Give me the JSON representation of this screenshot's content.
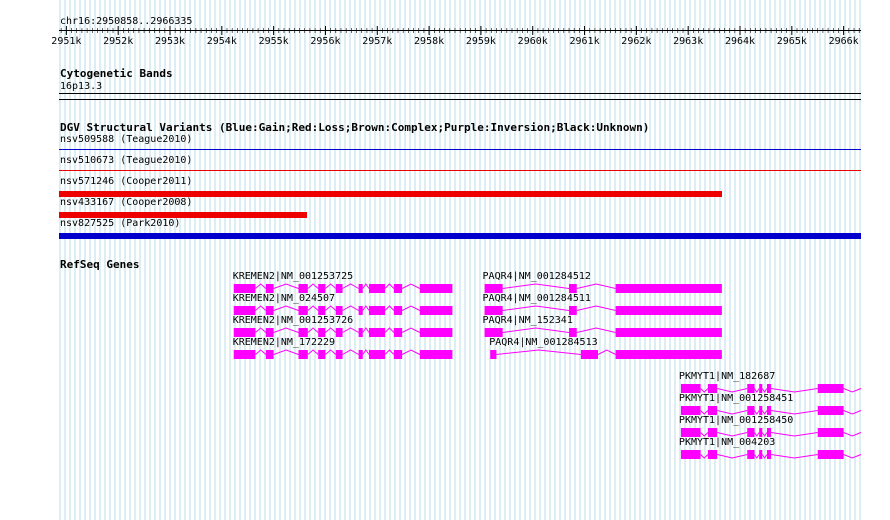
{
  "browser": {
    "region": "chr16:2950858..2966335",
    "region_start": 2950858,
    "region_end": 2966335,
    "ruler_ticks": [
      "2951k",
      "2952k",
      "2953k",
      "2954k",
      "2955k",
      "2956k",
      "2957k",
      "2958k",
      "2959k",
      "2960k",
      "2961k",
      "2962k",
      "2963k",
      "2964k",
      "2965k",
      "2966k"
    ],
    "ruler_tick_values": [
      2951000,
      2952000,
      2953000,
      2954000,
      2955000,
      2956000,
      2957000,
      2958000,
      2959000,
      2960000,
      2961000,
      2962000,
      2963000,
      2964000,
      2965000,
      2966000
    ],
    "colors": {
      "grid": "#b8dce8",
      "gain": "#0000cc",
      "loss": "#ee0000",
      "gene": "#ff00ff"
    }
  },
  "cytoband_track": {
    "title": "Cytogenetic Bands",
    "band": "16p13.3"
  },
  "dgv_track": {
    "title": "DGV Structural Variants (Blue:Gain;Red:Loss;Brown:Complex;Purple:Inversion;Black:Unknown)",
    "variants": [
      {
        "label": "nsv509588 (Teague2010)",
        "type": "gain",
        "style": "thin",
        "start": 2950858,
        "end": 2966335
      },
      {
        "label": "nsv510673 (Teague2010)",
        "type": "loss",
        "style": "thin",
        "start": 2950858,
        "end": 2966335
      },
      {
        "label": "nsv571246 (Cooper2011)",
        "type": "loss",
        "style": "thick",
        "start": 2950858,
        "end": 2963650
      },
      {
        "label": "nsv433167 (Cooper2008)",
        "type": "loss",
        "style": "thick",
        "start": 2950858,
        "end": 2955650
      },
      {
        "label": "nsv827525 (Park2010)",
        "type": "gain",
        "style": "thick",
        "start": 2950858,
        "end": 2966335
      }
    ]
  },
  "refseq_track": {
    "title": "RefSeq Genes",
    "genes": [
      {
        "label": "KREMEN2|NM_001253725",
        "strand": "+",
        "start": 2954230,
        "end": 2958450,
        "exons": [
          [
            2954230,
            2954650
          ],
          [
            2954850,
            2955000
          ],
          [
            2955480,
            2955660
          ],
          [
            2955860,
            2956000
          ],
          [
            2956200,
            2956330
          ],
          [
            2956640,
            2956720
          ],
          [
            2956840,
            2957150
          ],
          [
            2957320,
            2957480
          ],
          [
            2957820,
            2958450
          ]
        ]
      },
      {
        "label": "KREMEN2|NM_024507",
        "strand": "+",
        "start": 2954230,
        "end": 2958450,
        "exons": [
          [
            2954230,
            2954650
          ],
          [
            2954850,
            2955000
          ],
          [
            2955480,
            2955660
          ],
          [
            2955860,
            2956000
          ],
          [
            2956200,
            2956330
          ],
          [
            2956640,
            2956720
          ],
          [
            2956840,
            2957150
          ],
          [
            2957320,
            2957480
          ],
          [
            2957820,
            2958450
          ]
        ]
      },
      {
        "label": "KREMEN2|NM_001253726",
        "strand": "+",
        "start": 2954230,
        "end": 2958450,
        "exons": [
          [
            2954230,
            2954650
          ],
          [
            2954850,
            2955000
          ],
          [
            2955480,
            2955660
          ],
          [
            2955860,
            2956000
          ],
          [
            2956200,
            2956330
          ],
          [
            2956640,
            2956720
          ],
          [
            2956840,
            2957150
          ],
          [
            2957320,
            2957480
          ],
          [
            2957820,
            2958450
          ]
        ]
      },
      {
        "label": "KREMEN2|NM_172229",
        "strand": "+",
        "start": 2954230,
        "end": 2958450,
        "exons": [
          [
            2954230,
            2954650
          ],
          [
            2954850,
            2955000
          ],
          [
            2955480,
            2955660
          ],
          [
            2955860,
            2956000
          ],
          [
            2956200,
            2956330
          ],
          [
            2956640,
            2956720
          ],
          [
            2956840,
            2957150
          ],
          [
            2957320,
            2957480
          ],
          [
            2957820,
            2958450
          ]
        ]
      },
      {
        "label": "PAQR4|NM_001284512",
        "strand": "+",
        "start": 2959070,
        "end": 2963650,
        "exons": [
          [
            2959070,
            2959420
          ],
          [
            2960700,
            2960850
          ],
          [
            2961600,
            2963650
          ]
        ]
      },
      {
        "label": "PAQR4|NM_001284511",
        "strand": "+",
        "start": 2959070,
        "end": 2963650,
        "exons": [
          [
            2959070,
            2959420
          ],
          [
            2960700,
            2960850
          ],
          [
            2961600,
            2963650
          ]
        ]
      },
      {
        "label": "PAQR4|NM_152341",
        "strand": "+",
        "start": 2959070,
        "end": 2963650,
        "exons": [
          [
            2959070,
            2959420
          ],
          [
            2960700,
            2960850
          ],
          [
            2961600,
            2963650
          ]
        ]
      },
      {
        "label": "PAQR4|NM_001284513",
        "strand": "+",
        "start": 2959180,
        "end": 2963650,
        "exons": [
          [
            2959180,
            2959300
          ],
          [
            2960930,
            2961260
          ],
          [
            2961600,
            2963650
          ]
        ]
      },
      {
        "label": "PKMYT1|NM_182687",
        "strand": "-",
        "start": 2962860,
        "end": 2966335,
        "exons": [
          [
            2962860,
            2963240
          ],
          [
            2963380,
            2963560
          ],
          [
            2964140,
            2964280
          ],
          [
            2964370,
            2964430
          ],
          [
            2964520,
            2964600
          ],
          [
            2965500,
            2966000
          ]
        ]
      },
      {
        "label": "PKMYT1|NM_001258451",
        "strand": "-",
        "start": 2962860,
        "end": 2966335,
        "exons": [
          [
            2962860,
            2963240
          ],
          [
            2963380,
            2963560
          ],
          [
            2964140,
            2964280
          ],
          [
            2964370,
            2964430
          ],
          [
            2964520,
            2964600
          ],
          [
            2965500,
            2966000
          ]
        ]
      },
      {
        "label": "PKMYT1|NM_001258450",
        "strand": "-",
        "start": 2962860,
        "end": 2966335,
        "exons": [
          [
            2962860,
            2963240
          ],
          [
            2963380,
            2963560
          ],
          [
            2964140,
            2964280
          ],
          [
            2964370,
            2964430
          ],
          [
            2964520,
            2964600
          ],
          [
            2965500,
            2966000
          ]
        ]
      },
      {
        "label": "PKMYT1|NM_004203",
        "strand": "-",
        "start": 2962860,
        "end": 2966335,
        "exons": [
          [
            2962860,
            2963240
          ],
          [
            2963380,
            2963560
          ],
          [
            2964140,
            2964280
          ],
          [
            2964370,
            2964430
          ],
          [
            2964520,
            2964600
          ],
          [
            2965500,
            2966000
          ]
        ]
      }
    ]
  }
}
